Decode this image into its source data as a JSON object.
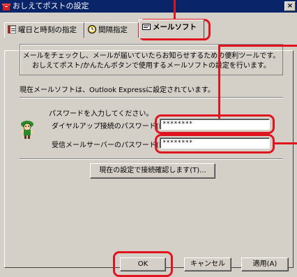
{
  "window": {
    "title": "おしえてポストの設定",
    "close_label": "×",
    "icon": "post-app-icon"
  },
  "tabs": [
    {
      "label": "曜日と時刻の指定",
      "icon": "calendar-icon"
    },
    {
      "label": "間隔指定",
      "icon": "clock-icon"
    },
    {
      "label": "メールソフト",
      "icon": "mail-software-icon"
    }
  ],
  "description": {
    "line1": "メールをチェックし、メールが届いていたらお知らせするための便利ツールです。",
    "line2": "おしえてポスト/かんたんボタンで使用するメールソフトの設定を行います。"
  },
  "current_mail_software": "現在メールソフトは、Outlook Expressに設定されています。",
  "password_prompt": "パスワードを入力してください。",
  "dialup": {
    "label": "ダイヤルアップ接続のパスワード(D):",
    "value": "********"
  },
  "incoming": {
    "label": "受信メールサーバーのパスワード(P):",
    "value": "********"
  },
  "test_button": "現在の設定で接続確認します(T)...",
  "footer": {
    "ok": "OK",
    "cancel": "キャンセル",
    "apply": "適用(A)"
  },
  "colors": {
    "highlight_ring": "#e0141e",
    "title_bar": "#0a246a",
    "dialog_face": "#d4d0c8"
  }
}
